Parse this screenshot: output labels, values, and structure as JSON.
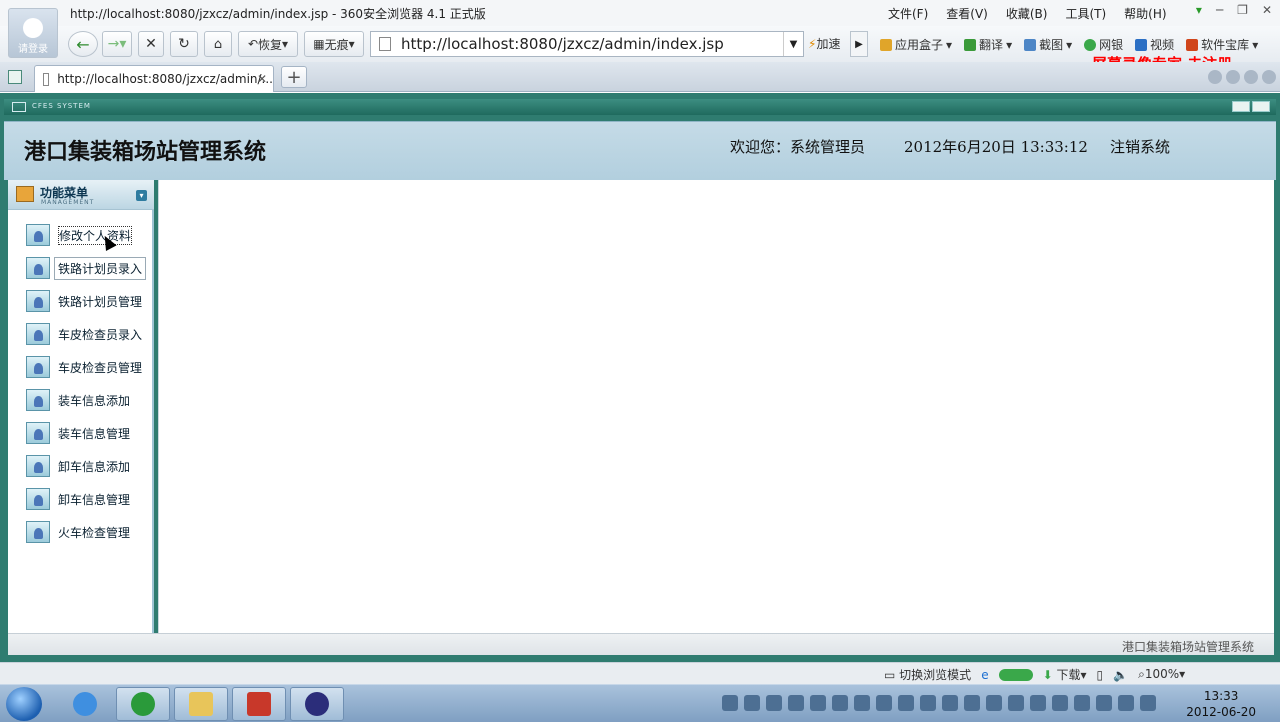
{
  "browser": {
    "window_title": "http://localhost:8080/jzxcz/admin/index.jsp - 360安全浏览器 4.1 正式版",
    "login_label": "请登录",
    "menu": [
      "文件(F)",
      "查看(V)",
      "收藏(B)",
      "工具(T)",
      "帮助(H)"
    ],
    "toolbar": {
      "restore_label": "恢复",
      "incognito_label": "无痕",
      "address": "http://localhost:8080/jzxcz/admin/index.jsp",
      "speedup_label": "加速",
      "app_box_label": "应用盒子",
      "translate_label": "翻译",
      "screenshot_label": "截图",
      "netbank_label": "网银",
      "video_label": "视频",
      "software_label": "软件宝库"
    },
    "watermark": "屏幕录像专家 未注册",
    "tab": {
      "title": "http://localhost:8080/jzxcz/admin/..."
    },
    "status": {
      "switch_mode_label": "切换浏览模式",
      "download_label": "下载",
      "zoom": "100%"
    }
  },
  "page": {
    "cfes_label": "CFES SYSTEM",
    "system_title": "港口集装箱场站管理系统",
    "welcome": "欢迎您：系统管理员",
    "datetime": "2012年6月20日  13:33:12",
    "logout": "注销系统",
    "menu_title": "功能菜单",
    "menu_subtitle": "MANAGEMENT",
    "menu_items": [
      "修改个人资料",
      "铁路计划员录入",
      "铁路计划员管理",
      "车皮检查员录入",
      "车皮检查员管理",
      "装车信息添加",
      "装车信息管理",
      "卸车信息添加",
      "卸车信息管理",
      "火车检查管理"
    ],
    "footer": "港口集装箱场站管理系统"
  },
  "taskbar": {
    "time": "13:33",
    "date": "2012-06-20"
  }
}
